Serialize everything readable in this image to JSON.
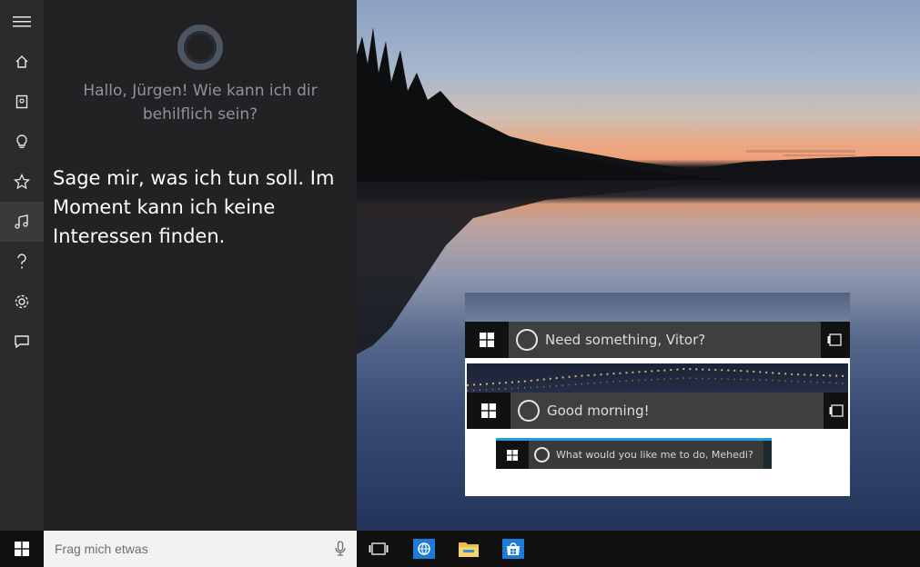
{
  "cortana": {
    "greeting": "Hallo, Jürgen! Wie kann ich dir behilflich sein?",
    "message": "Sage mir, was ich tun soll. Im Moment kann ich keine Interessen finden."
  },
  "rail": {
    "items": [
      {
        "icon": "hamburger-menu-icon"
      },
      {
        "icon": "home-icon"
      },
      {
        "icon": "notebook-icon"
      },
      {
        "icon": "lightbulb-icon"
      },
      {
        "icon": "star-icon"
      },
      {
        "icon": "music-note-icon",
        "active": true
      },
      {
        "icon": "help-icon"
      },
      {
        "icon": "settings-gear-icon"
      },
      {
        "icon": "feedback-icon"
      }
    ]
  },
  "taskbar": {
    "search_placeholder": "Frag mich etwas",
    "apps": [
      "internet-explorer-icon",
      "file-explorer-icon",
      "store-icon"
    ]
  },
  "collage": {
    "bars": [
      {
        "text": "Need something, Vitor?"
      },
      {
        "text": "Good morning!"
      },
      {
        "text": "What would you like me to do, Mehedi?"
      }
    ]
  },
  "colors": {
    "panel_bg": "#222224",
    "rail_bg": "#2b2b2b",
    "taskbar_bg": "#101010",
    "accent": "#1e9fd6"
  }
}
